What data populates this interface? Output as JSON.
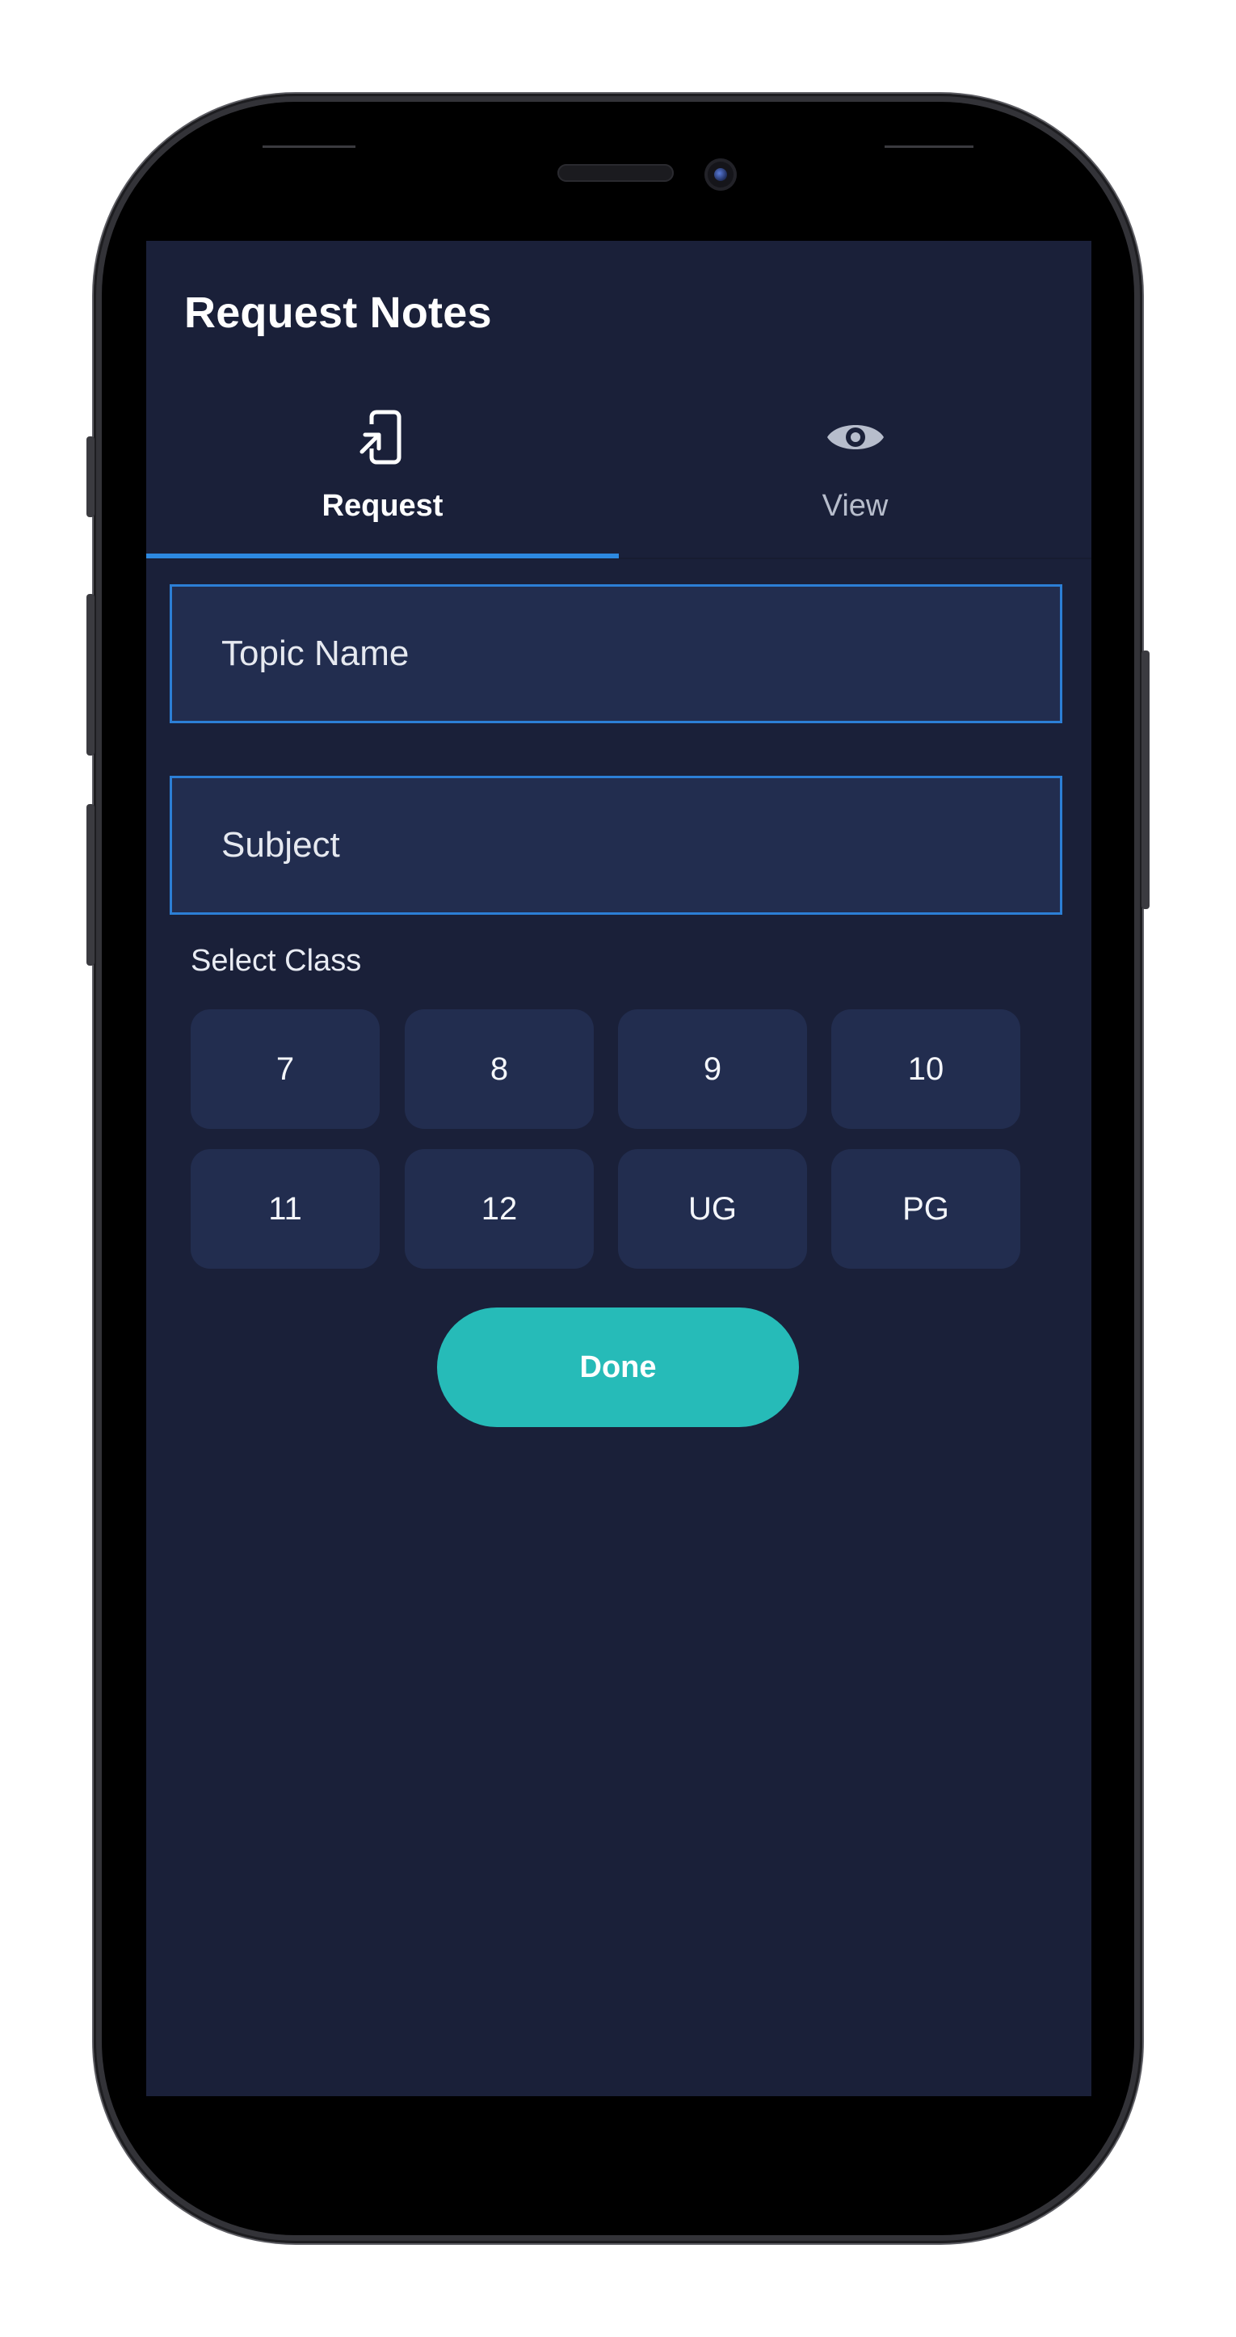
{
  "app": {
    "title": "Request Notes"
  },
  "tabs": [
    {
      "label": "Request",
      "icon": "phone-request-icon",
      "active": true
    },
    {
      "label": "View",
      "icon": "eye-icon",
      "active": false
    }
  ],
  "form": {
    "topic_placeholder": "Topic Name",
    "topic_value": "",
    "subject_placeholder": "Subject",
    "subject_value": "",
    "select_class_label": "Select Class",
    "classes": [
      "7",
      "8",
      "9",
      "10",
      "11",
      "12",
      "UG",
      "PG"
    ],
    "done_label": "Done"
  },
  "colors": {
    "screen_background": "#1a2039",
    "field_background": "#222d4f",
    "accent_blue": "#2d89e0",
    "done_button": "#26bbb8"
  }
}
